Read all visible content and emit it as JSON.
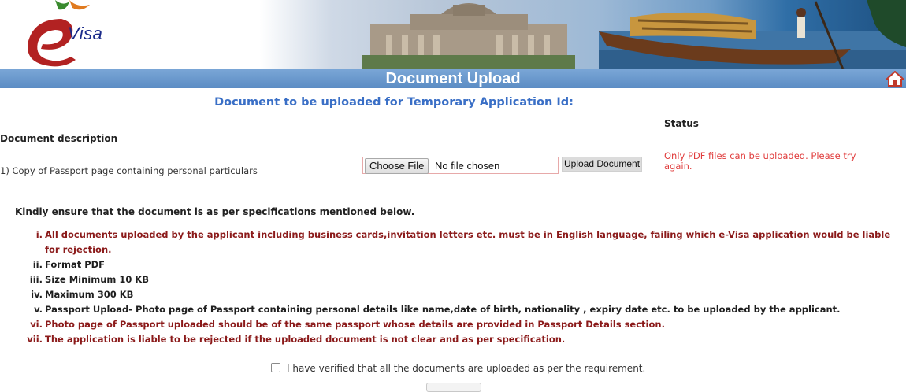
{
  "banner": {
    "logo_text": "Visa"
  },
  "header": {
    "title": "Document Upload"
  },
  "subtitle": "Document to be uploaded for Temporary Application Id:",
  "table": {
    "status_header": "Status",
    "description_header": "Document description",
    "rows": [
      {
        "description": "1) Copy of Passport page containing personal particulars",
        "choose_file_label": "Choose File",
        "file_status": "No file chosen",
        "upload_label": "Upload Document",
        "status": "Only PDF files can be uploaded. Please try again."
      }
    ]
  },
  "specs": {
    "intro": "Kindly ensure that the document is as per specifications mentioned below.",
    "items": [
      {
        "num": "i.",
        "text": "All documents uploaded by the applicant including business cards,invitation letters etc. must be in English language, failing which e-Visa application would be liable for rejection."
      },
      {
        "num": "ii.",
        "text": "Format PDF"
      },
      {
        "num": "iii.",
        "text": "Size Minimum 10 KB"
      },
      {
        "num": "iv.",
        "text": "Maximum 300 KB"
      },
      {
        "num": "v.",
        "text": "Passport Upload- Photo page of Passport containing personal details like name,date of birth, nationality , expiry date etc. to be uploaded by the applicant."
      },
      {
        "num": "vi.",
        "text": "Photo page of Passport uploaded should be of the same passport whose details are provided in Passport Details section."
      },
      {
        "num": "vii.",
        "text": "The application is liable to be rejected if the uploaded document is not clear and as per specification."
      }
    ]
  },
  "verify_label": "I have verified that all the documents are uploaded as per the requirement.",
  "colors": {
    "title_bar": "#6b9bd0",
    "subtitle": "#3a6fc6",
    "status_error": "#e03c3c",
    "spec_red": "#8b1a1a",
    "logo_green": "#3a8a2e",
    "logo_red": "#b22222"
  },
  "icons": {
    "home": "home-icon",
    "logo": "evisa-logo-icon"
  }
}
